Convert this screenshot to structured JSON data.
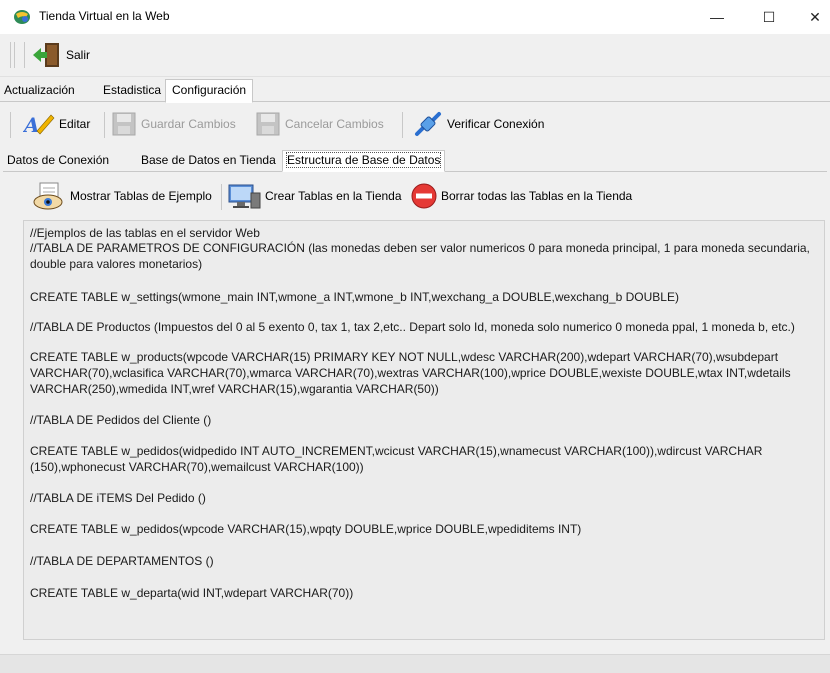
{
  "window": {
    "title": "Tienda Virtual en la Web",
    "minimize": "—",
    "maximize": "☐",
    "close": "✕"
  },
  "toolbar": {
    "exit_label": "Salir"
  },
  "main_tabs": [
    "Actualización",
    "Estadistica",
    "Configuración"
  ],
  "config_toolbar": {
    "edit": "Editar",
    "save": "Guardar Cambios",
    "cancel": "Cancelar Cambios",
    "verify": "Verificar Conexión"
  },
  "sub_tabs": [
    "Datos de Conexión",
    "Base de Datos en Tienda",
    "Estructura de Base de Datos"
  ],
  "tables_toolbar": {
    "show": "Mostrar Tablas de Ejemplo",
    "create": "Crear Tablas en la Tienda",
    "delete": "Borrar todas las Tablas en la Tienda"
  },
  "textarea": {
    "lines": [
      "//Ejemplos de las tablas en el servidor Web",
      "//TABLA DE PARAMETROS DE CONFIGURACIÓN  (las monedas deben ser valor numericos 0 para moneda principal, 1 para moneda secundaria,",
      "double para valores monetarios)",
      "CREATE TABLE w_settings(wmone_main INT,wmone_a INT,wmone_b INT,wexchang_a DOUBLE,wexchang_b DOUBLE)",
      "//TABLA DE Productos (Impuestos del 0 al 5 exento 0, tax 1, tax 2,etc.. Depart solo Id, moneda solo numerico 0 moneda ppal, 1 moneda b, etc.)",
      "CREATE TABLE w_products(wpcode VARCHAR(15) PRIMARY KEY NOT NULL,wdesc VARCHAR(200),wdepart VARCHAR(70),wsubdepart",
      "VARCHAR(70),wclasifica VARCHAR(70),wmarca VARCHAR(70),wextras VARCHAR(100),wprice DOUBLE,wexiste DOUBLE,wtax INT,wdetails",
      "VARCHAR(250),wmedida INT,wref VARCHAR(15),wgarantia VARCHAR(50))",
      "//TABLA DE Pedidos del Cliente ()",
      "CREATE TABLE w_pedidos(widpedido INT AUTO_INCREMENT,wcicust VARCHAR(15),wnamecust VARCHAR(100)),wdircust VARCHAR",
      "(150),wphonecust VARCHAR(70),wemailcust VARCHAR(100))",
      "//TABLA DE iTEMS Del Pedido ()",
      "CREATE TABLE w_pedidos(wpcode VARCHAR(15),wpqty DOUBLE,wprice DOUBLE,wpediditems INT)",
      "//TABLA DE DEPARTAMENTOS ()",
      "CREATE TABLE w_departa(wid INT,wdepart VARCHAR(70))"
    ]
  }
}
